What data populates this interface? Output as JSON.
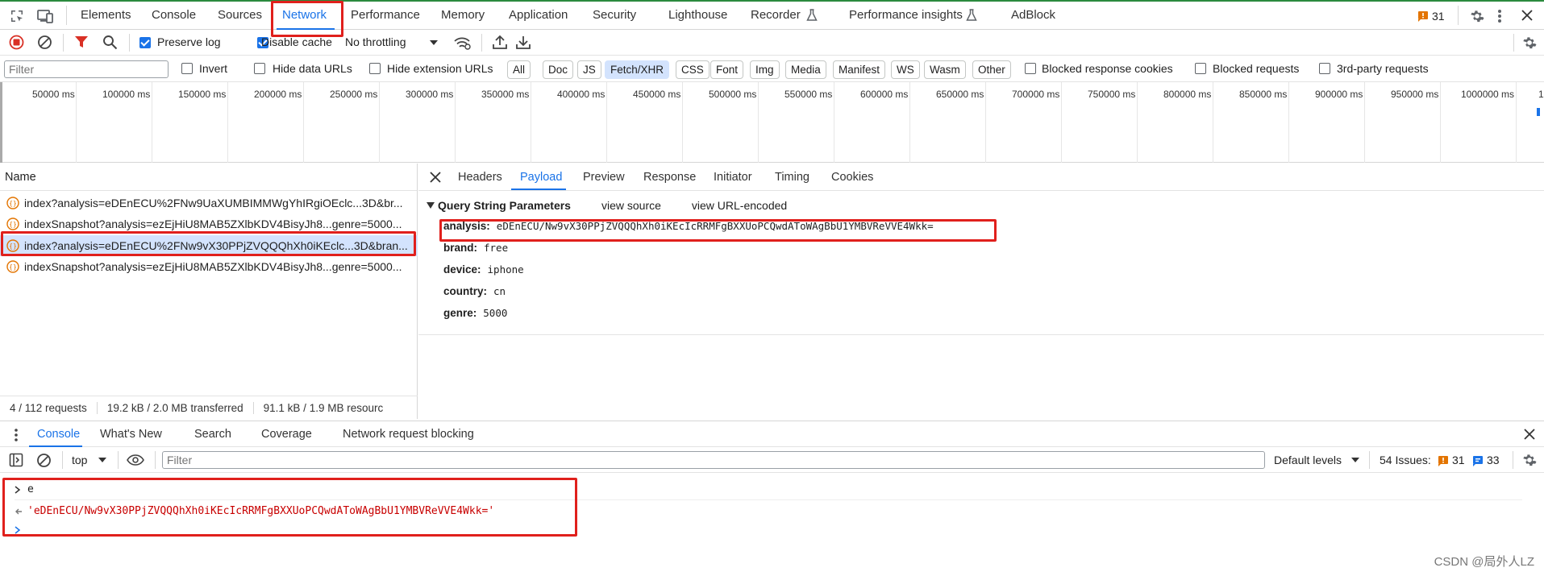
{
  "top_tabs": [
    "Elements",
    "Console",
    "Sources",
    "Network",
    "Performance",
    "Memory",
    "Application",
    "Security",
    "Lighthouse",
    "Recorder",
    "Performance insights",
    "AdBlock"
  ],
  "issues_count": "31",
  "toolbar": {
    "preserve_log": "Preserve log",
    "disable_cache": "Disable cache",
    "throttling": "No throttling"
  },
  "filter": {
    "placeholder": "Filter",
    "invert": "Invert",
    "hide_data_urls": "Hide data URLs",
    "hide_extension_urls": "Hide extension URLs",
    "types": [
      "All",
      "Doc",
      "JS",
      "Fetch/XHR",
      "CSS",
      "Font",
      "Img",
      "Media",
      "Manifest",
      "WS",
      "Wasm",
      "Other"
    ],
    "blocked_cookies": "Blocked response cookies",
    "blocked_requests": "Blocked requests",
    "third_party": "3rd-party requests"
  },
  "timeline_ticks": [
    "50000 ms",
    "100000 ms",
    "150000 ms",
    "200000 ms",
    "250000 ms",
    "300000 ms",
    "350000 ms",
    "400000 ms",
    "450000 ms",
    "500000 ms",
    "550000 ms",
    "600000 ms",
    "650000 ms",
    "700000 ms",
    "750000 ms",
    "800000 ms",
    "850000 ms",
    "900000 ms",
    "950000 ms",
    "1000000 ms",
    "1"
  ],
  "request_list": {
    "header": "Name",
    "rows": [
      "index?analysis=eDEnECU%2FNw9UaXUMBIMMWgYhIRgiOEclc...3D&br...",
      "indexSnapshot?analysis=ezEjHiU8MAB5ZXlbKDV4BisyJh8...genre=5000...",
      "index?analysis=eDEnECU%2FNw9vX30PPjZVQQQhXh0iKEclc...3D&bran...",
      "indexSnapshot?analysis=ezEjHiU8MAB5ZXlbKDV4BisyJh8...genre=5000..."
    ],
    "footer": [
      "4 / 112 requests",
      "19.2 kB / 2.0 MB transferred",
      "91.1 kB / 1.9 MB resourc"
    ]
  },
  "detail_tabs": [
    "Headers",
    "Payload",
    "Preview",
    "Response",
    "Initiator",
    "Timing",
    "Cookies"
  ],
  "payload": {
    "section_title": "Query String Parameters",
    "view_source": "view source",
    "view_url_encoded": "view URL-encoded",
    "params": [
      {
        "key": "analysis:",
        "value": "eDEnECU/Nw9vX30PPjZVQQQhXh0iKEcIcRRMFgBXXUoPCQwdAToWAgBbU1YMBVReVVE4Wkk="
      },
      {
        "key": "brand:",
        "value": "free"
      },
      {
        "key": "device:",
        "value": "iphone"
      },
      {
        "key": "country:",
        "value": "cn"
      },
      {
        "key": "genre:",
        "value": "5000"
      }
    ]
  },
  "drawer_tabs": [
    "Console",
    "What's New",
    "Search",
    "Coverage",
    "Network request blocking"
  ],
  "console_toolbar": {
    "context": "top",
    "filter_placeholder": "Filter",
    "levels": "Default levels",
    "issues_label": "54 Issues:",
    "warn_count": "31",
    "info_count": "33"
  },
  "console_lines": {
    "input": "e",
    "output": "'eDEnECU/Nw9vX30PPjZVQQQhXh0iKEcIcRRMFgBXXUoPCQwdAToWAgBbU1YMBVReVVE4Wkk='"
  },
  "watermark": "CSDN @局外人LZ",
  "colors": {
    "accent": "#1a73e8",
    "highlight": "#e0201c",
    "string": "#c80000"
  }
}
